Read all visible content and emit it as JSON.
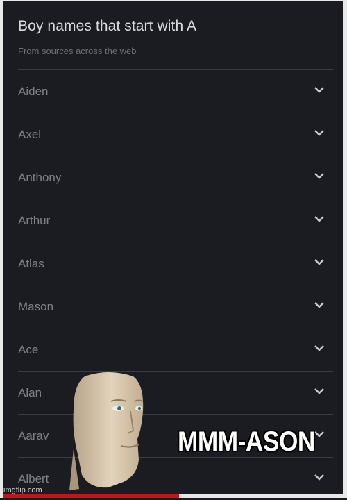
{
  "header": {
    "title": "Boy names that start with A",
    "subtitle": "From sources across the web"
  },
  "names": [
    {
      "label": "Aiden"
    },
    {
      "label": "Axel"
    },
    {
      "label": "Anthony"
    },
    {
      "label": "Arthur"
    },
    {
      "label": "Atlas"
    },
    {
      "label": "Mason"
    },
    {
      "label": "Ace"
    },
    {
      "label": "Alan"
    },
    {
      "label": "Aarav"
    },
    {
      "label": "Albert"
    }
  ],
  "meme": {
    "caption": "MMM-ASON",
    "character": "meme-man-head"
  },
  "watermark": "imgflip.com",
  "colors": {
    "background": "#1b1c21",
    "row_text": "#7e8187",
    "divider": "#3a3c42",
    "progress_red": "#c4141a"
  }
}
